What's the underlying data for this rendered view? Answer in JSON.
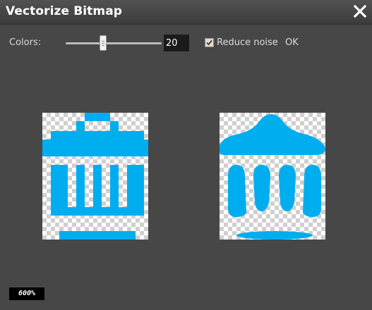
{
  "window": {
    "title": "Vectorize Bitmap"
  },
  "icons": {
    "close": "close-icon",
    "checkbox": "checkmark-icon"
  },
  "controls": {
    "colors_label": "Colors:",
    "colors_value": "20",
    "colors_min": 2,
    "colors_max": 64,
    "noise_label": "Reduce noise",
    "noise_checked": true,
    "ok_label": "OK"
  },
  "previews": {
    "original": {
      "icon": "trash-can-pixel-icon",
      "color": "#00adef"
    },
    "vectorized": {
      "icon": "trash-can-vector-icon",
      "color": "#00adef"
    }
  },
  "zoom": {
    "label": "600%"
  },
  "colors": {
    "background": "#474747",
    "accent": "#00adef",
    "title_bar": "#444444"
  }
}
